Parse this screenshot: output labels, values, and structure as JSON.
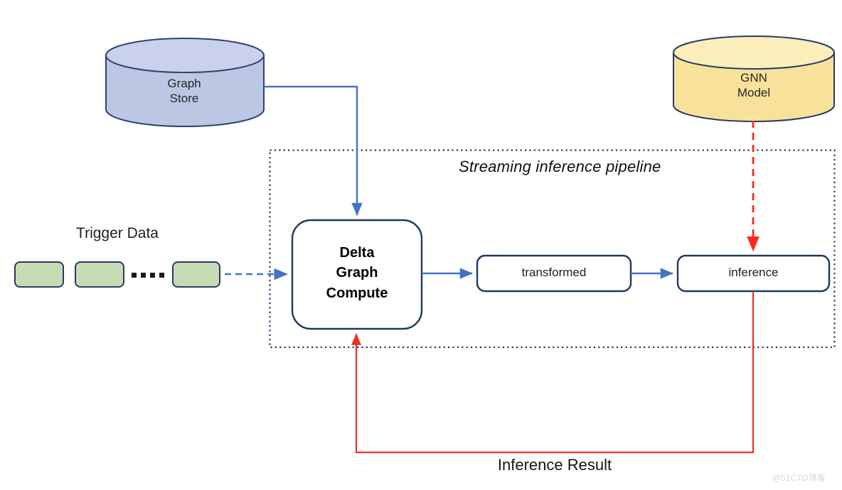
{
  "diagram": {
    "title_italic": "Streaming inference pipeline",
    "nodes": {
      "graph_store": {
        "label": "Graph\nStore",
        "fill": "#bcc7e4",
        "stroke": "#2e4372"
      },
      "gnn_model": {
        "label": "GNN\nModel",
        "fill": "#f8e29b",
        "stroke": "#2b3a63"
      },
      "delta_compute": {
        "label": "Delta\nGraph\nCompute",
        "fill": "#ffffff",
        "stroke": "#1f3864"
      },
      "transformed": {
        "label": "transformed",
        "fill": "#ffffff",
        "stroke": "#1f3864"
      },
      "inference": {
        "label": "inference",
        "fill": "#ffffff",
        "stroke": "#1f3864"
      }
    },
    "trigger": {
      "heading": "Trigger Data",
      "ellipsis": "……",
      "box_fill": "#c6dbb4",
      "box_stroke": "#2b3a63",
      "count": 3
    },
    "edges": {
      "graph_store_to_compute": {
        "style": "solid",
        "color": "#4472c4"
      },
      "trigger_to_compute": {
        "style": "dashed",
        "color": "#4472c4"
      },
      "compute_to_transformed": {
        "style": "solid",
        "color": "#4472c4"
      },
      "transformed_to_inference": {
        "style": "solid",
        "color": "#4472c4"
      },
      "gnn_to_inference": {
        "style": "dashed",
        "color": "#ff2a1a"
      },
      "inference_to_compute": {
        "style": "solid",
        "color": "#ee3124",
        "label": "Inference Result"
      }
    },
    "pipeline_border": {
      "style": "dotted",
      "color": "#1f3864"
    }
  },
  "watermark": {
    "text": "@51CTO博客"
  }
}
